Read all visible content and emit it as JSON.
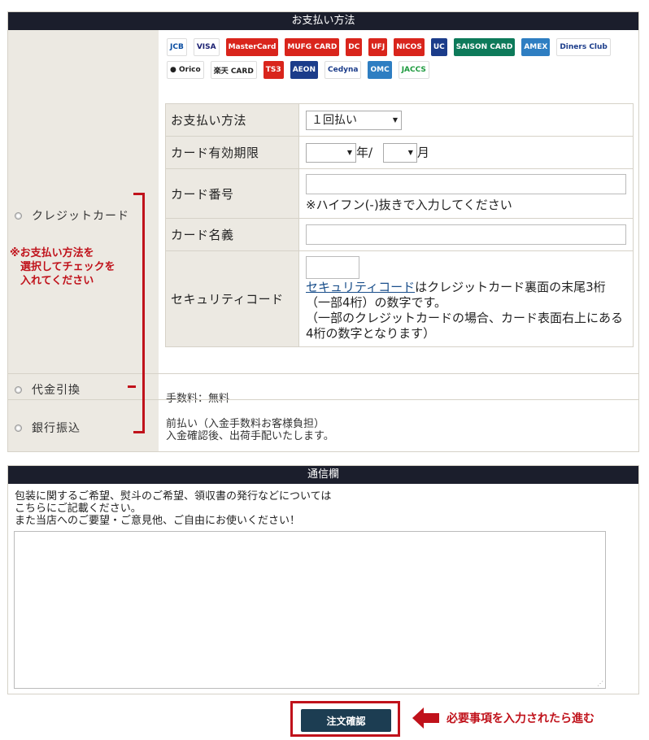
{
  "payment": {
    "title": "お支払い方法",
    "options": [
      {
        "label": "クレジットカード"
      },
      {
        "label": "代金引換"
      },
      {
        "label": "銀行振込"
      }
    ],
    "note": "※お支払い方法を\n　選択してチェックを\n　入れてください",
    "card_logos": [
      {
        "name": "jcb-logo",
        "text": "JCB",
        "bg": "#ffffff",
        "fg": "#0b4ea2"
      },
      {
        "name": "visa-logo",
        "text": "VISA",
        "bg": "#ffffff",
        "fg": "#1a1f71"
      },
      {
        "name": "mastercard-logo",
        "text": "MasterCard",
        "bg": "#d9251c",
        "fg": "#ffffff"
      },
      {
        "name": "muji-card-logo",
        "text": "MUFG CARD",
        "bg": "#d9251c",
        "fg": "#ffffff"
      },
      {
        "name": "dc-logo",
        "text": "DC",
        "bg": "#d9251c",
        "fg": "#ffffff"
      },
      {
        "name": "ufj-logo",
        "text": "UFJ",
        "bg": "#d9251c",
        "fg": "#ffffff"
      },
      {
        "name": "nicos-logo",
        "text": "NICOS",
        "bg": "#d9251c",
        "fg": "#ffffff"
      },
      {
        "name": "uc-logo",
        "text": "UC",
        "bg": "#1b3c8a",
        "fg": "#ffffff"
      },
      {
        "name": "saison-card-logo",
        "text": "SAISON CARD",
        "bg": "#0d7a5a",
        "fg": "#ffffff"
      },
      {
        "name": "amex-logo",
        "text": "AMEX",
        "bg": "#2e7ec2",
        "fg": "#ffffff"
      },
      {
        "name": "diners-club-logo",
        "text": "Diners Club",
        "bg": "#ffffff",
        "fg": "#1b3c8a"
      },
      {
        "name": "orico-logo",
        "text": "● Orico",
        "bg": "#ffffff",
        "fg": "#222222"
      },
      {
        "name": "rakuten-logo",
        "text": "楽天 CARD",
        "bg": "#ffffff",
        "fg": "#222222"
      },
      {
        "name": "ts3-logo",
        "text": "TS3",
        "bg": "#d9251c",
        "fg": "#ffffff"
      },
      {
        "name": "aeon-logo",
        "text": "AEON",
        "bg": "#1b3c8a",
        "fg": "#ffffff"
      },
      {
        "name": "cedyna-logo",
        "text": "Cedyna",
        "bg": "#ffffff",
        "fg": "#1b3c8a"
      },
      {
        "name": "omc-logo",
        "text": "OMC",
        "bg": "#2e7ec2",
        "fg": "#ffffff"
      },
      {
        "name": "jaccs-logo",
        "text": "JACCS",
        "bg": "#ffffff",
        "fg": "#1d9a3e"
      }
    ],
    "form": {
      "method_label": "お支払い方法",
      "method_value": "１回払い",
      "expiry_label": "カード有効期限",
      "expiry_year_suffix": "年/",
      "expiry_month_suffix": "月",
      "number_label": "カード番号",
      "number_hint": "※ハイフン(-)抜きで入力してください",
      "name_label": "カード名義",
      "security_label": "セキュリティコード",
      "security_link": "セキュリティコード",
      "security_text": "はクレジットカード裏面の末尾3桁（一部4桁）の数字です。",
      "security_text2": "（一部のクレジットカードの場合、カード表面右上にある4桁の数字となります）"
    },
    "cod_fee": "手数料：無料",
    "bank_line1": "前払い（入金手数料お客様負担）",
    "bank_line2": "入金確認後、出荷手配いたします。"
  },
  "message": {
    "title": "通信欄",
    "line1": "包装に関するご希望、熨斗のご希望、領収書の発行などについては",
    "line2": "こちらにご記載ください。",
    "line3": "また当店へのご要望・ご意見他、ご自由にお使いください！",
    "value": ""
  },
  "submit": {
    "label": "注文確認",
    "proceed": "必要事項を入力されたら進む"
  },
  "colors": {
    "header": "#1b1e2c",
    "accent_red": "#c0121b",
    "label_bg": "#ece9e2",
    "button": "#1c3d52"
  }
}
